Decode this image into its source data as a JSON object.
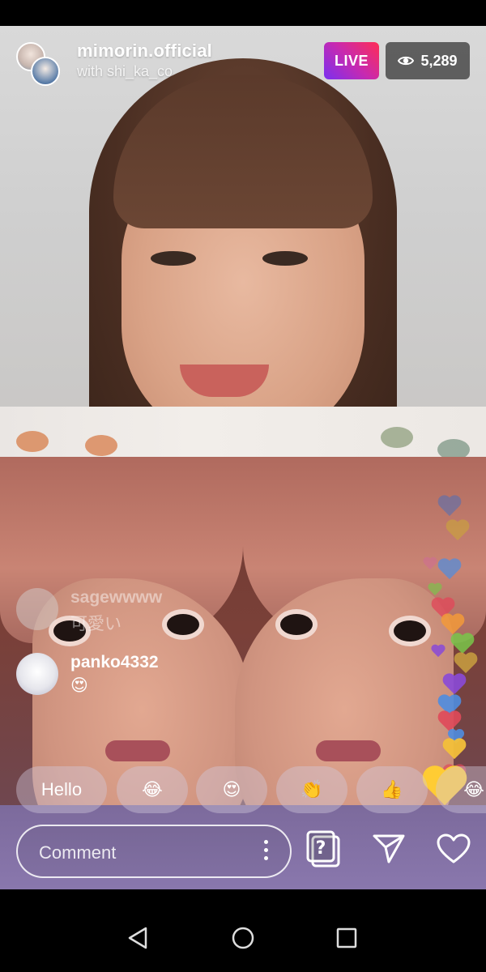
{
  "header": {
    "host_username": "mimorin.official",
    "with_line": "with shi_ka_co",
    "live_label": "LIVE",
    "viewer_count": "5,289"
  },
  "comments": [
    {
      "username": "sagewwww",
      "text": "可愛い",
      "faded": true
    },
    {
      "username": "panko4332",
      "text": "😍",
      "faded": false
    }
  ],
  "quick_replies": [
    "Hello",
    "😂",
    "😍",
    "👏",
    "👍",
    "😂"
  ],
  "comment_input": {
    "placeholder": "Comment"
  },
  "icons": {
    "viewers": "eye-icon",
    "more": "more-vertical-icon",
    "questions": "question-cards-icon",
    "share": "paper-plane-icon",
    "like": "heart-outline-icon",
    "nav_back": "triangle-back-icon",
    "nav_home": "circle-home-icon",
    "nav_recents": "square-recents-icon"
  },
  "colors": {
    "live_gradient": [
      "#7a2ff0",
      "#c72ab0",
      "#ff2d55"
    ],
    "heart_colors": [
      "#4f8de0",
      "#caa040",
      "#e04a5a",
      "#8a4ad8",
      "#f4c03a",
      "#79c64a",
      "#e07aa8",
      "#ffcc33"
    ]
  }
}
